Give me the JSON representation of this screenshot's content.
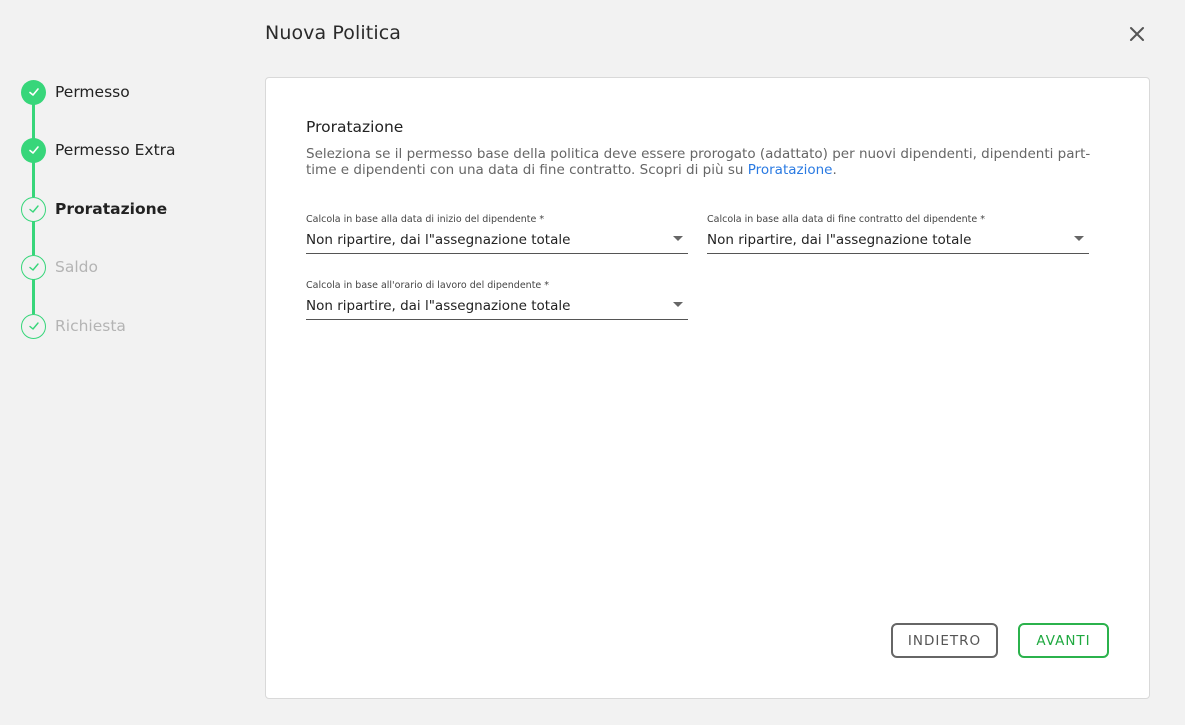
{
  "dialog": {
    "title": "Nuova Politica",
    "close_icon": "close-icon"
  },
  "stepper": {
    "accent_color": "#37d67a",
    "steps": [
      {
        "label": "Permesso",
        "state": "done"
      },
      {
        "label": "Permesso Extra",
        "state": "done"
      },
      {
        "label": "Proratazione",
        "state": "active"
      },
      {
        "label": "Saldo",
        "state": "pending"
      },
      {
        "label": "Richiesta",
        "state": "pending"
      }
    ]
  },
  "content": {
    "title": "Proratazione",
    "description": "Seleziona se il permesso base della politica deve essere prorogato (adattato) per nuovi dipendenti, dipendenti part-time e dipendenti con una data di fine contratto. Scopri di più su ",
    "link_label": "Proratazione",
    "description_end": ".",
    "link_color": "#2a7ae2",
    "fields": [
      {
        "label": "Calcola in base alla data di inizio del dipendente *",
        "value": "Non ripartire, dai l\"assegnazione totale"
      },
      {
        "label": "Calcola in base alla data di fine contratto del dipendente *",
        "value": "Non ripartire, dai l\"assegnazione totale"
      },
      {
        "label": "Calcola in base all'orario di lavoro del dipendente *",
        "value": "Non ripartire, dai l\"assegnazione totale"
      }
    ]
  },
  "footer": {
    "back_label": "INDIETRO",
    "next_label": "AVANTI",
    "next_color": "#2bb24c"
  }
}
